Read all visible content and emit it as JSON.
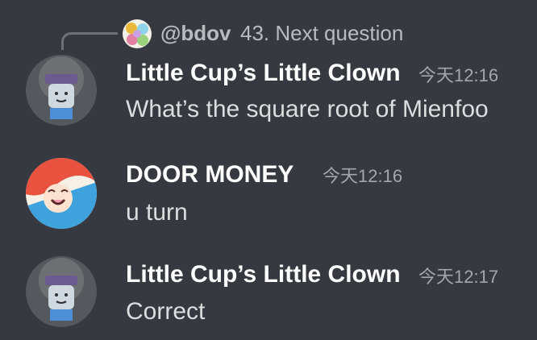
{
  "reply": {
    "username": "@bdov",
    "text": "43. Next question"
  },
  "messages": [
    {
      "author": "Little Cup’s Little Clown",
      "timestamp": "今天12:16",
      "content": "What’s the square root of Mienfoo"
    },
    {
      "author": "DOOR MONEY",
      "timestamp": "今天12:16",
      "content": "u turn"
    },
    {
      "author": "Little Cup’s Little Clown",
      "timestamp": "今天12:17",
      "content": "Correct"
    }
  ],
  "colors": {
    "background": "#36393f",
    "author": "#ffffff",
    "message_text": "#dcddde",
    "timestamp": "#a3a6aa",
    "reply_text": "#b9bbbe"
  }
}
